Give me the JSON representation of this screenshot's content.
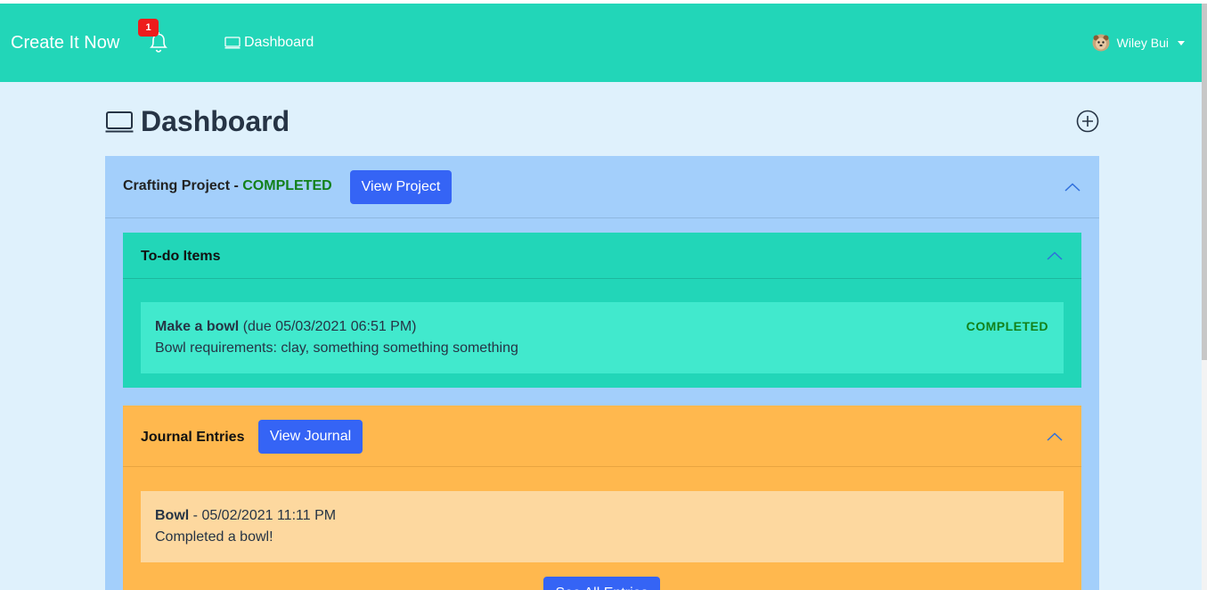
{
  "navbar": {
    "brand": "Create It Now",
    "notification_count": "1",
    "dashboard_link": "Dashboard",
    "user_name": "Wiley Bui",
    "bg_color": "#22d6b8"
  },
  "page": {
    "title": "Dashboard",
    "add_icon": "plus-circle-icon"
  },
  "project": {
    "name": "Crafting Project",
    "separator": " - ",
    "status": "COMPLETED",
    "view_button": "View Project",
    "todo": {
      "title": "To-do Items",
      "items": [
        {
          "name": "Make a bowl",
          "due": "(due 05/03/2021 06:51 PM)",
          "description": "Bowl requirements: clay, something something something",
          "status": "COMPLETED"
        }
      ]
    },
    "journal": {
      "title": "Journal Entries",
      "view_button": "View Journal",
      "entries": [
        {
          "name": "Bowl",
          "date": " - 05/02/2021 11:11 PM",
          "text": "Completed a bowl!"
        }
      ],
      "see_all_button": "See All Entries"
    }
  },
  "colors": {
    "project_bg": "#a3cffb",
    "todo_bg": "#22d6b8",
    "journal_bg": "#ffb84e",
    "primary_button": "#3564f5",
    "completed": "#128019"
  }
}
